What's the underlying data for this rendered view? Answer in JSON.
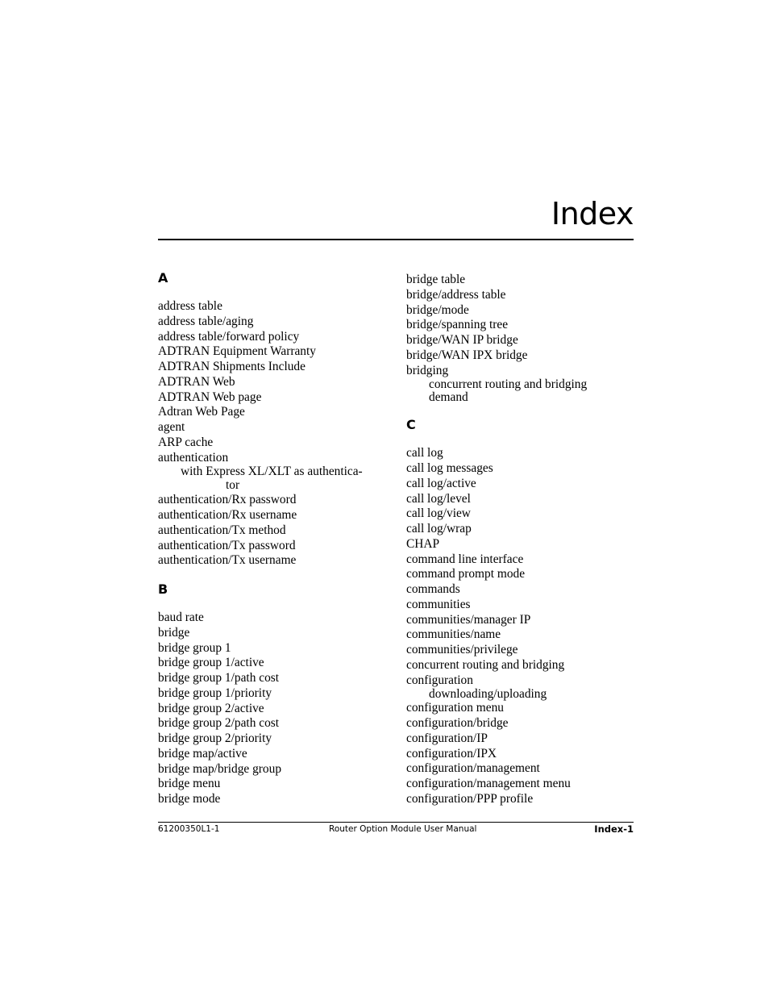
{
  "page": {
    "title": "Index"
  },
  "columns": {
    "left": [
      {
        "letter": "A",
        "entries": [
          {
            "text": "address table"
          },
          {
            "text": "address table/aging"
          },
          {
            "text": "address table/forward policy"
          },
          {
            "text": "ADTRAN Equipment Warranty"
          },
          {
            "text": "ADTRAN Shipments Include"
          },
          {
            "text": "ADTRAN Web"
          },
          {
            "text": "ADTRAN Web page"
          },
          {
            "text": "Adtran Web Page"
          },
          {
            "text": "agent"
          },
          {
            "text": "ARP cache"
          },
          {
            "text": "authentication",
            "sub": [
              "with Express XL/XLT as authentica-"
            ],
            "sub_cont": "tor"
          },
          {
            "text": "authentication/Rx password"
          },
          {
            "text": "authentication/Rx username"
          },
          {
            "text": "authentication/Tx method"
          },
          {
            "text": "authentication/Tx password"
          },
          {
            "text": "authentication/Tx username"
          }
        ]
      },
      {
        "letter": "B",
        "entries": [
          {
            "text": "baud rate"
          },
          {
            "text": "bridge"
          },
          {
            "text": "bridge group 1"
          },
          {
            "text": "bridge group 1/active"
          },
          {
            "text": "bridge group 1/path cost"
          },
          {
            "text": "bridge group 1/priority"
          },
          {
            "text": "bridge group 2/active"
          },
          {
            "text": "bridge group 2/path cost"
          },
          {
            "text": "bridge group 2/priority"
          },
          {
            "text": "bridge map/active"
          },
          {
            "text": "bridge map/bridge group"
          },
          {
            "text": "bridge menu"
          },
          {
            "text": "bridge mode"
          }
        ]
      }
    ],
    "right": [
      {
        "letter": "",
        "entries": [
          {
            "text": "bridge table"
          },
          {
            "text": "bridge/address table"
          },
          {
            "text": "bridge/mode"
          },
          {
            "text": "bridge/spanning tree"
          },
          {
            "text": "bridge/WAN IP bridge"
          },
          {
            "text": "bridge/WAN IPX bridge"
          },
          {
            "text": "bridging",
            "sub": [
              "concurrent routing and bridging",
              "demand"
            ]
          }
        ]
      },
      {
        "letter": "C",
        "entries": [
          {
            "text": "call log"
          },
          {
            "text": "call log messages"
          },
          {
            "text": "call log/active"
          },
          {
            "text": "call log/level"
          },
          {
            "text": "call log/view"
          },
          {
            "text": "call log/wrap"
          },
          {
            "text": "CHAP"
          },
          {
            "text": "command line interface"
          },
          {
            "text": "command prompt mode"
          },
          {
            "text": "commands"
          },
          {
            "text": "communities"
          },
          {
            "text": "communities/manager IP"
          },
          {
            "text": "communities/name"
          },
          {
            "text": "communities/privilege"
          },
          {
            "text": "concurrent routing and bridging"
          },
          {
            "text": "configuration",
            "sub": [
              "downloading/uploading"
            ]
          },
          {
            "text": "configuration menu"
          },
          {
            "text": "configuration/bridge"
          },
          {
            "text": "configuration/IP"
          },
          {
            "text": "configuration/IPX"
          },
          {
            "text": "configuration/management"
          },
          {
            "text": "configuration/management menu"
          },
          {
            "text": "configuration/PPP profile"
          }
        ]
      }
    ]
  },
  "footer": {
    "doc_number": "61200350L1-1",
    "manual_title": "Router Option Module User Manual",
    "page_label": "Index-1"
  }
}
